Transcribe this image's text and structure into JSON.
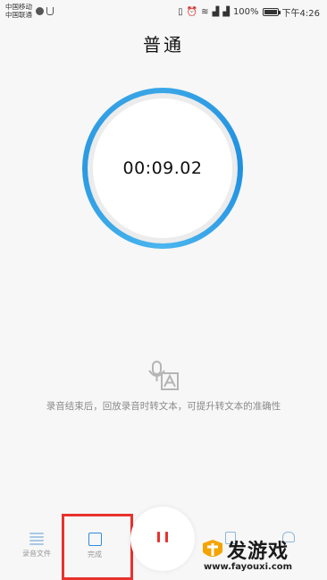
{
  "status_bar": {
    "carrier_1": "中国移动",
    "carrier_2": "中国联通",
    "battery": "100%",
    "time": "下午4:26"
  },
  "header": {
    "title": "普通"
  },
  "timer": {
    "elapsed": "00:09.02"
  },
  "hint": {
    "text": "录音结束后，回放录音时转文本，可提升转文本的准确性"
  },
  "bottom_bar": {
    "files_label": "录音文件",
    "done_label": "完成"
  },
  "watermark": {
    "name": "发游戏",
    "url": "www.fayouxi.com"
  },
  "colors": {
    "accent": "#2f8ae0",
    "ring": "#3aa6e6",
    "record_red": "#e8322e",
    "highlight": "#e8322e"
  },
  "icons": [
    "wifi-icon",
    "signal-icon",
    "alarm-icon",
    "battery-icon",
    "list-icon",
    "stop-icon",
    "pause-icon",
    "transcribe-icon"
  ]
}
